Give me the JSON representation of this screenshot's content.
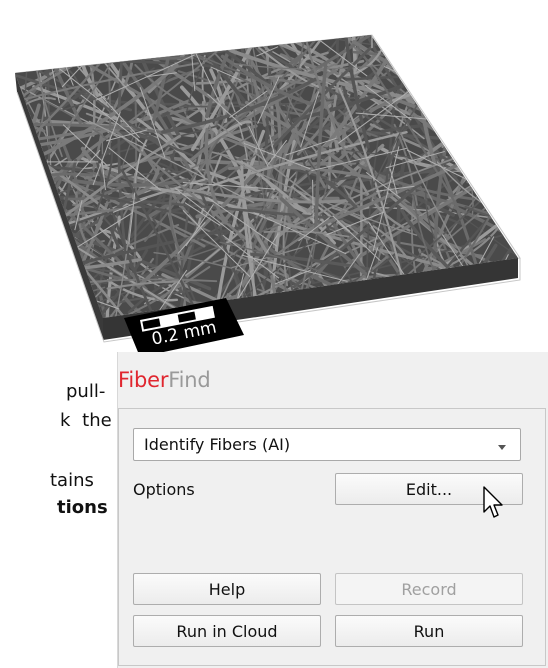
{
  "scale_bar": {
    "label": "0.2 mm"
  },
  "document_fragments": {
    "line1": "pull-",
    "line2": "k the",
    "line3": "tains",
    "line4": "tions"
  },
  "panel": {
    "title_part1": "Fiber",
    "title_part2": "Find",
    "title_color_part1": "#e0262f",
    "title_color_part2": "#9a9a9a",
    "dropdown": {
      "selected": "Identify Fibers (AI)"
    },
    "options_label": "Options",
    "edit_button": "Edit...",
    "help_button": "Help",
    "record_button": "Record",
    "run_in_cloud_button": "Run in Cloud",
    "run_button": "Run"
  }
}
